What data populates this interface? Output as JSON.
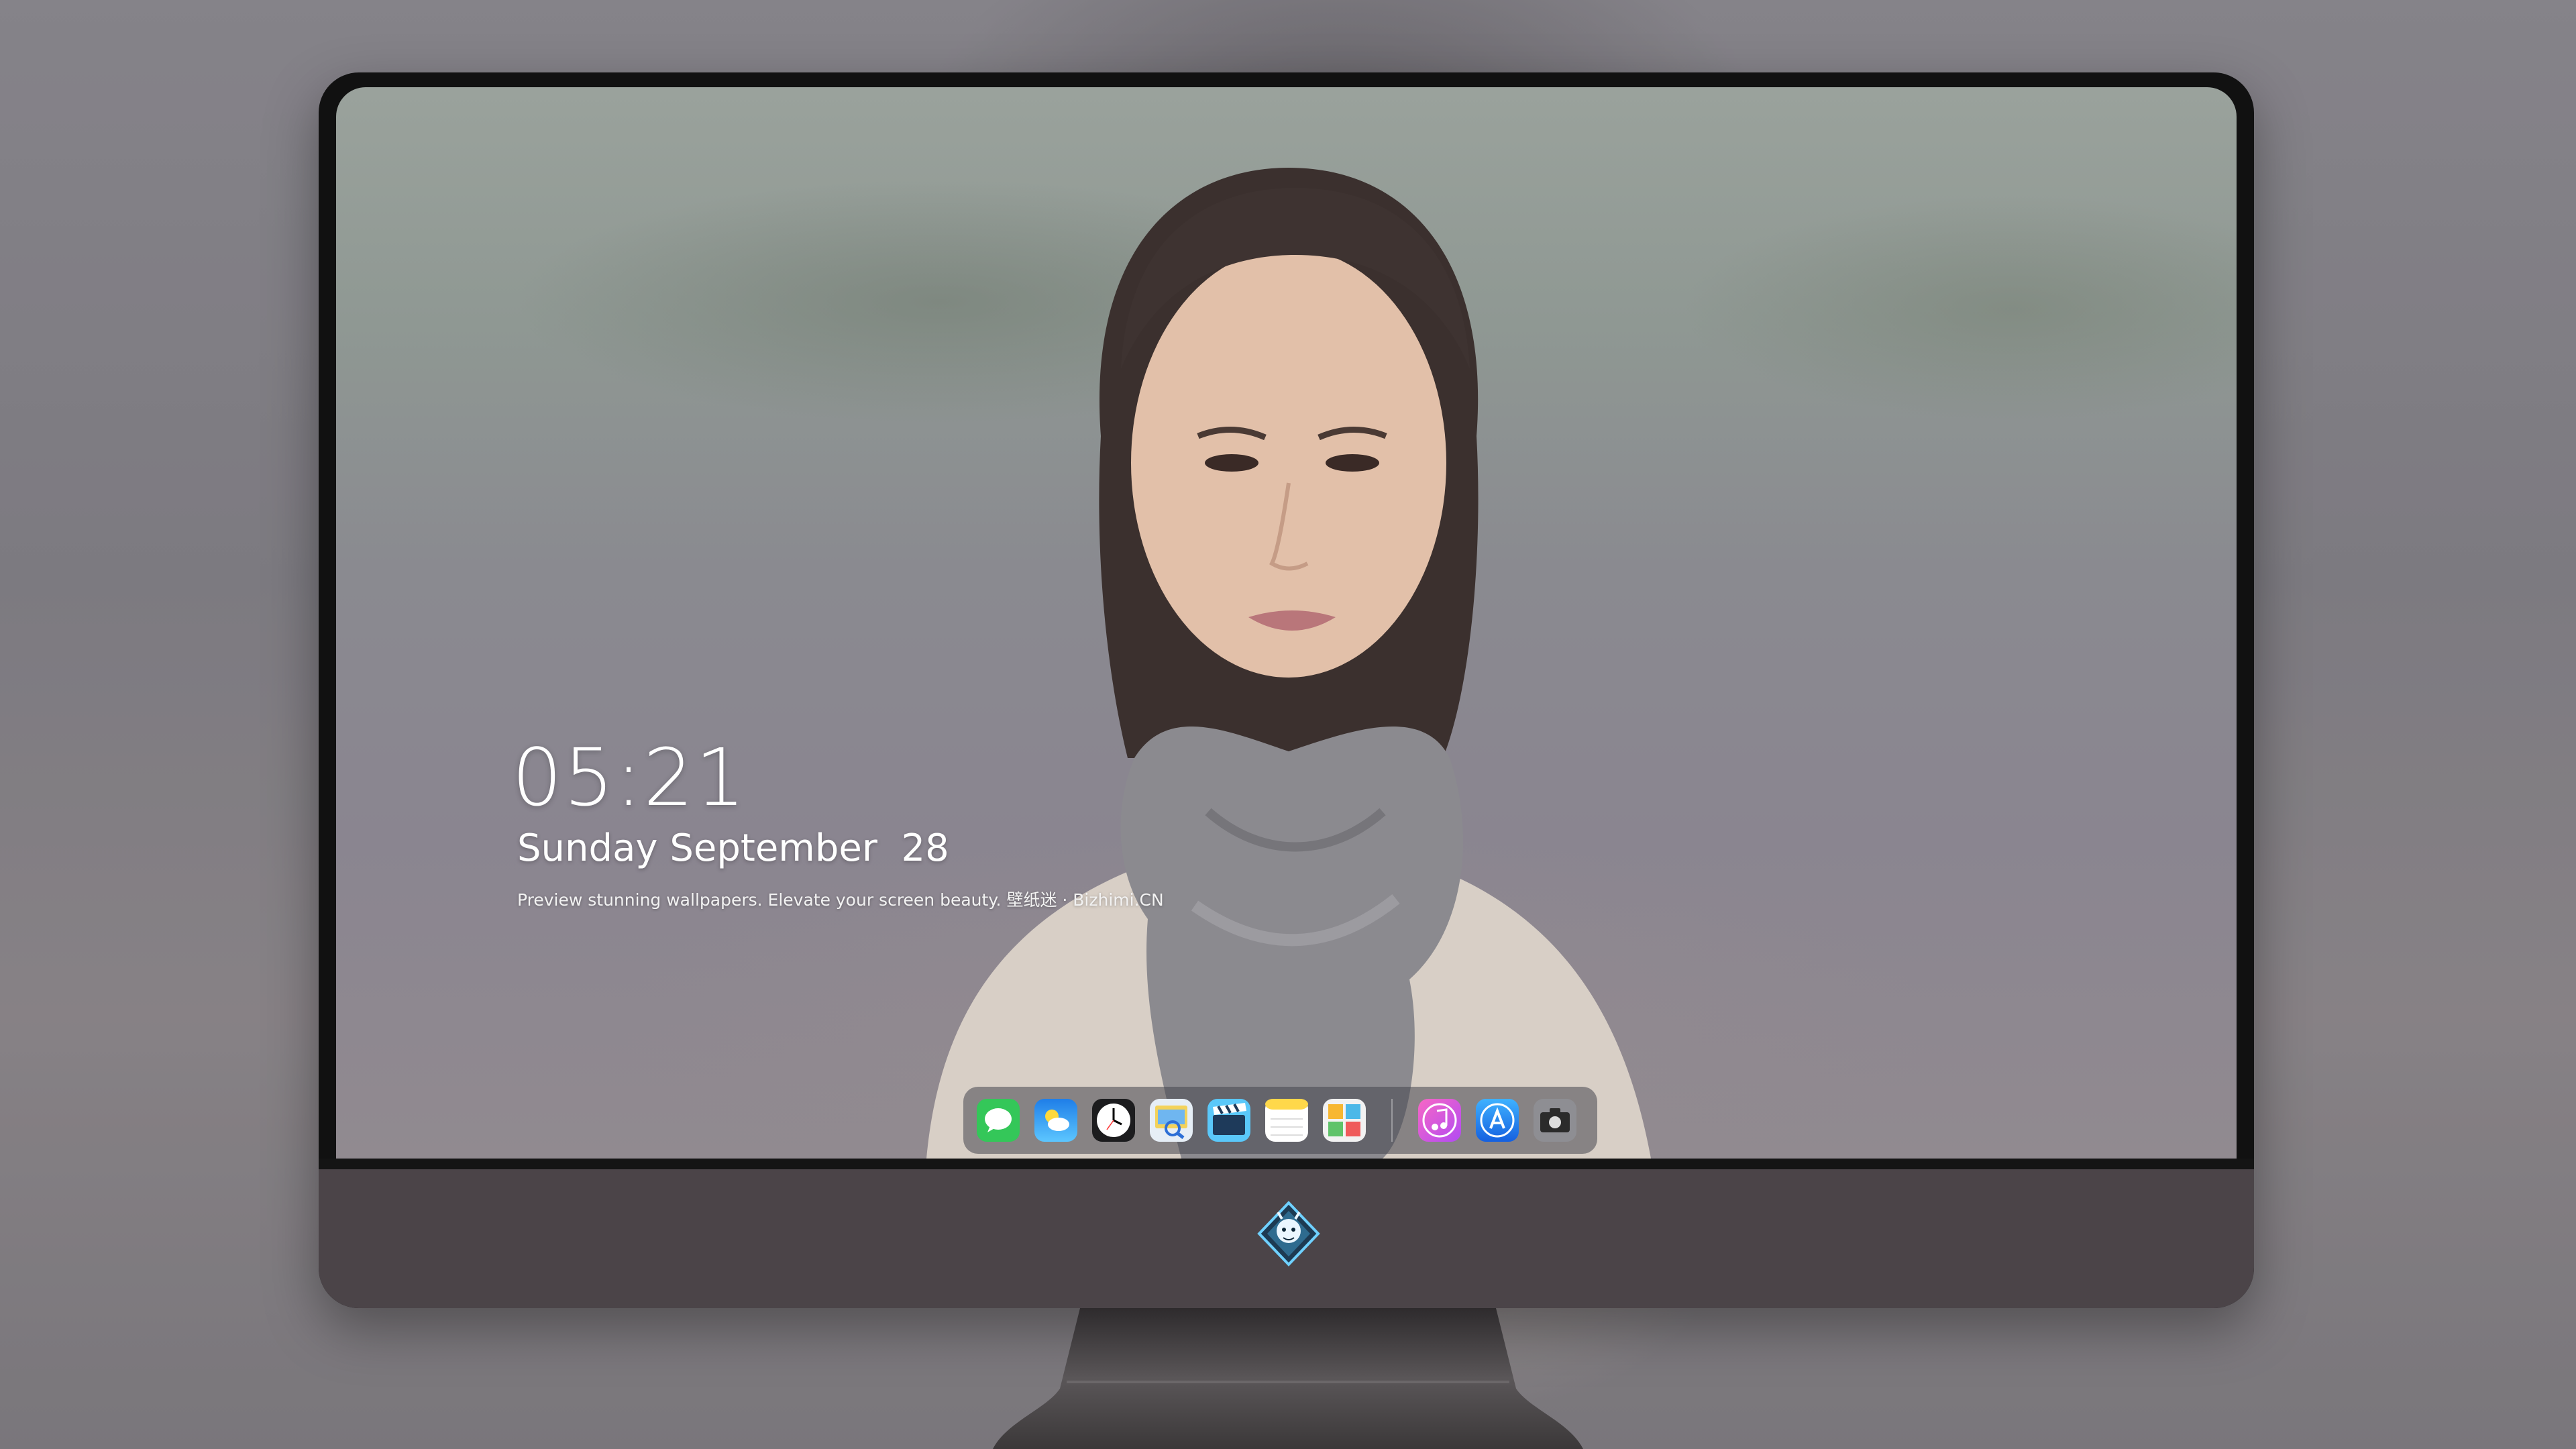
{
  "lockscreen": {
    "time": "05:21",
    "date": "Sunday September  28",
    "tagline": "Preview stunning wallpapers. Elevate your screen beauty. 壁纸迷 · Bizhimi.CN"
  },
  "dock": {
    "apps": [
      {
        "name": "Messages",
        "icon": "messages-icon",
        "color": "#34c759"
      },
      {
        "name": "Weather",
        "icon": "weather-icon",
        "color": "#2a9df4"
      },
      {
        "name": "Clock",
        "icon": "clock-icon",
        "color": "#ffffff"
      },
      {
        "name": "Preview",
        "icon": "preview-icon",
        "color": "#e8d06a"
      },
      {
        "name": "Clips",
        "icon": "clips-icon",
        "color": "#5ac8fa"
      },
      {
        "name": "Notes",
        "icon": "notes-icon",
        "color": "#ffd84a"
      },
      {
        "name": "Calendar",
        "icon": "calendar-icon",
        "color": "#f2f2f2"
      },
      {
        "name": "Music",
        "icon": "music-icon",
        "color": "#f05fd8"
      },
      {
        "name": "App Store",
        "icon": "app-store-icon",
        "color": "#1e8cf0"
      },
      {
        "name": "Camera",
        "icon": "camera-icon",
        "color": "#8e8e93"
      }
    ]
  },
  "monitor": {
    "logo_icon": "dragon-mascot-logo-icon"
  }
}
